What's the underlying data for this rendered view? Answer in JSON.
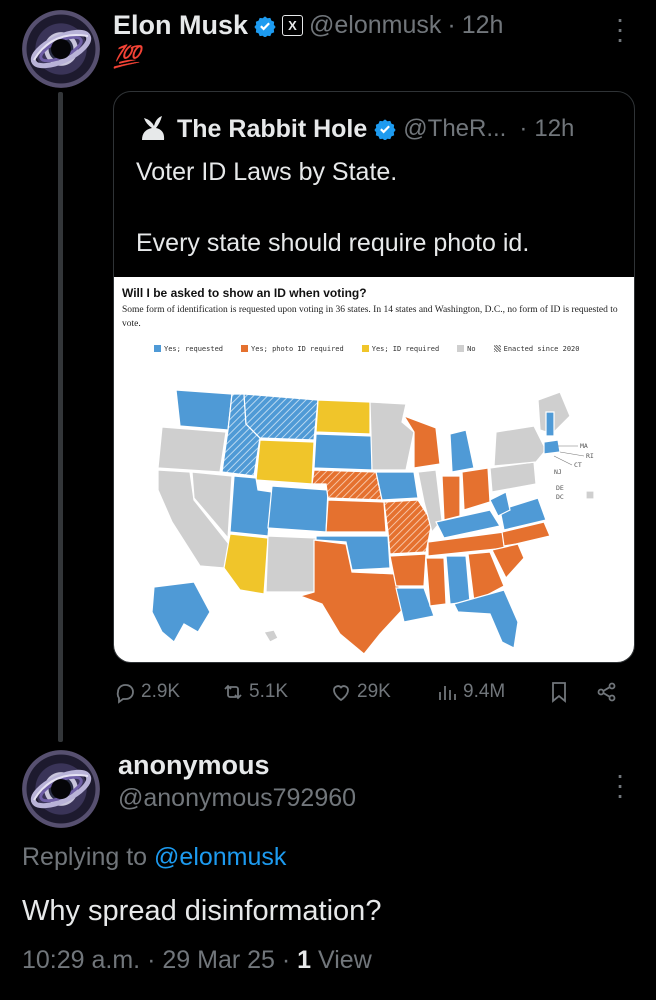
{
  "tweet": {
    "author_name": "Elon Musk",
    "x_badge": "X",
    "handle": "@elonmusk",
    "separator": "·",
    "time": "12h",
    "emoji": "💯",
    "quote": {
      "author_name": "The Rabbit Hole",
      "handle": "@TheR...",
      "separator": "·",
      "time": "12h",
      "line1": "Voter ID Laws by State.",
      "line2": "Every state should require photo id.",
      "map": {
        "title": "Will I be asked to show an ID when voting?",
        "subtitle": "Some form of identification is requested upon voting in 36 states. In 14 states and Washington, D.C., no form of ID is requested to vote.",
        "legend": [
          {
            "label": "Yes; requested",
            "color": "#4f9ad6"
          },
          {
            "label": "Yes; photo ID required",
            "color": "#e5712f"
          },
          {
            "label": "Yes; ID required",
            "color": "#f0c52a"
          },
          {
            "label": "No",
            "color": "#cfcfcf"
          },
          {
            "label": "Enacted since 2020",
            "color": "#888888"
          }
        ],
        "state_labels": [
          "MA",
          "RI",
          "CT",
          "NJ",
          "DE",
          "DC"
        ]
      }
    },
    "stats": {
      "replies": "2.9K",
      "reposts": "5.1K",
      "likes": "29K",
      "views": "9.4M"
    },
    "colors": {
      "verified": "#1d9bf0",
      "link": "#1d9bf0",
      "muted": "#71767b"
    }
  },
  "reply": {
    "author_name": "anonymous",
    "handle": "@anonymous792960",
    "replying_prefix": "Replying to",
    "replying_to": "@elonmusk",
    "text": "Why spread disinformation?",
    "time": "10:29 a.m.",
    "date": "29 Mar 25",
    "separator": "·",
    "views_count": "1",
    "views_label": "View"
  }
}
